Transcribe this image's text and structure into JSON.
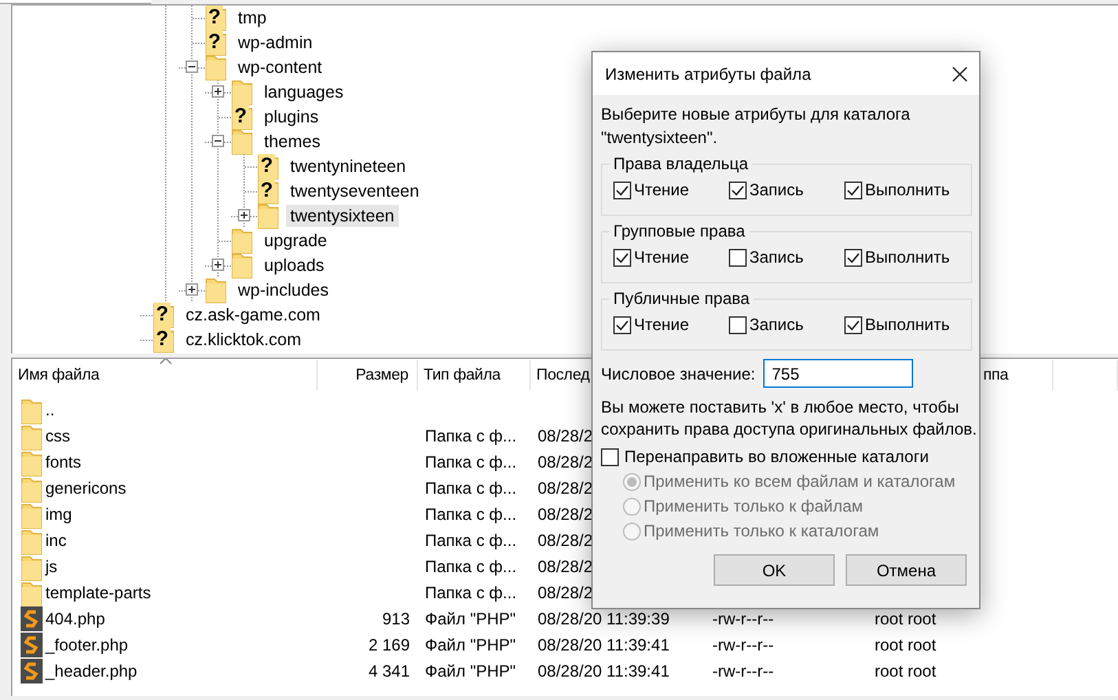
{
  "tree": {
    "items": [
      {
        "children": [
          {
            "children": [
              {
                "label": "tmp",
                "badge": "?",
                "selected": false
              },
              {
                "label": "wp-admin",
                "badge": "?",
                "selected": false
              },
              {
                "label": "wp-content",
                "expanded": true,
                "selected": false,
                "children": [
                  {
                    "label": "languages",
                    "expanded": false,
                    "selected": false
                  },
                  {
                    "label": "plugins",
                    "badge": "?",
                    "selected": false
                  },
                  {
                    "label": "themes",
                    "expanded": true,
                    "selected": false,
                    "children": [
                      {
                        "label": "twentynineteen",
                        "badge": "?",
                        "selected": false
                      },
                      {
                        "label": "twentyseventeen",
                        "badge": "?",
                        "selected": false
                      },
                      {
                        "label": "twentysixteen",
                        "expanded": false,
                        "selected": true
                      }
                    ]
                  },
                  {
                    "label": "upgrade",
                    "selected": false
                  },
                  {
                    "label": "uploads",
                    "expanded": false,
                    "selected": false
                  }
                ]
              },
              {
                "label": "wp-includes",
                "expanded": false,
                "selected": false
              }
            ]
          }
        ]
      },
      {
        "label": "cz.ask-game.com",
        "badge": "?",
        "selected": false
      },
      {
        "label": "cz.klicktok.com",
        "badge": "?",
        "selected": false
      }
    ]
  },
  "file_list": {
    "columns": [
      {
        "label": "Имя файла",
        "sorted": true
      },
      {
        "label": "Размер",
        "sorted": false
      },
      {
        "label": "Тип файла",
        "sorted": false
      },
      {
        "label": "Послед",
        "sorted": false
      },
      {
        "label": "ппа",
        "sorted": false
      }
    ],
    "rows": [
      {
        "kind": "folder",
        "name": ".."
      },
      {
        "kind": "folder",
        "name": "css",
        "type": "Папка с ф...",
        "date": "08/28/2"
      },
      {
        "kind": "folder",
        "name": "fonts",
        "type": "Папка с ф...",
        "date": "08/28/2"
      },
      {
        "kind": "folder",
        "name": "genericons",
        "type": "Папка с ф...",
        "date": "08/28/2"
      },
      {
        "kind": "folder",
        "name": "img",
        "type": "Папка с ф...",
        "date": "08/28/2"
      },
      {
        "kind": "folder",
        "name": "inc",
        "type": "Папка с ф...",
        "date": "08/28/2"
      },
      {
        "kind": "folder",
        "name": "js",
        "type": "Папка с ф...",
        "date": "08/28/2"
      },
      {
        "kind": "folder",
        "name": "template-parts",
        "type": "Папка с ф...",
        "date": "08/28/2"
      },
      {
        "kind": "php",
        "name": "404.php",
        "size": "913",
        "type": "Файл \"PHP\"",
        "date": "08/28/20 11:39:39",
        "permissions": "-rw-r--r--",
        "owner": "root root"
      },
      {
        "kind": "php",
        "name": "_footer.php",
        "size": "2 169",
        "type": "Файл \"PHP\"",
        "date": "08/28/20 11:39:41",
        "permissions": "-rw-r--r--",
        "owner": "root root"
      },
      {
        "kind": "php",
        "name": "_header.php",
        "size": "4 341",
        "type": "Файл \"PHP\"",
        "date": "08/28/20 11:39:41",
        "permissions": "-rw-r--r--",
        "owner": "root root"
      }
    ]
  },
  "dialog": {
    "title": "Изменить атрибуты файла",
    "prompt": "Выберите новые атрибуты для каталога \"twentysixteen\".",
    "groups": [
      {
        "title": "Права владельца",
        "permissions": [
          {
            "label": "Чтение",
            "checked": true
          },
          {
            "label": "Запись",
            "checked": true
          },
          {
            "label": "Выполнить",
            "checked": true
          }
        ]
      },
      {
        "title": "Групповые права",
        "permissions": [
          {
            "label": "Чтение",
            "checked": true
          },
          {
            "label": "Запись",
            "checked": false
          },
          {
            "label": "Выполнить",
            "checked": true
          }
        ]
      },
      {
        "title": "Публичные права",
        "permissions": [
          {
            "label": "Чтение",
            "checked": true
          },
          {
            "label": "Запись",
            "checked": false
          },
          {
            "label": "Выполнить",
            "checked": true
          }
        ]
      }
    ],
    "numeric": {
      "label": "Числовое значение:",
      "value": "755"
    },
    "hint": "Вы можете поставить 'x' в любое место, чтобы сохранить права доступа оригинальных файлов.",
    "recurse": {
      "label": "Перенаправить во вложенные каталоги",
      "checked": false
    },
    "apply_options": [
      {
        "label": "Применить ко всем файлам и каталогам",
        "selected": true,
        "disabled": true
      },
      {
        "label": "Применить только к файлам",
        "selected": false,
        "disabled": true
      },
      {
        "label": "Применить только к каталогам",
        "selected": false,
        "disabled": true
      }
    ],
    "buttons": [
      {
        "label": "OK"
      },
      {
        "label": "Отмена"
      }
    ]
  }
}
